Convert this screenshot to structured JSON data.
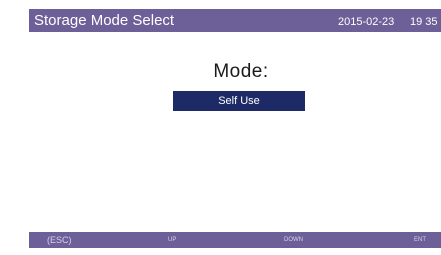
{
  "header": {
    "title": "Storage Mode Select",
    "date": "2015-02-23",
    "time": "19 35"
  },
  "main": {
    "mode_label": "Mode:",
    "mode_value": "Self Use"
  },
  "footer": {
    "esc_label": "(ESC)",
    "up_label": "UP",
    "down_label": "DOWN",
    "ent_label": "ENT"
  },
  "colors": {
    "bar": "#6d5f98",
    "selected": "#1e2a66",
    "background": "#ffffff"
  }
}
